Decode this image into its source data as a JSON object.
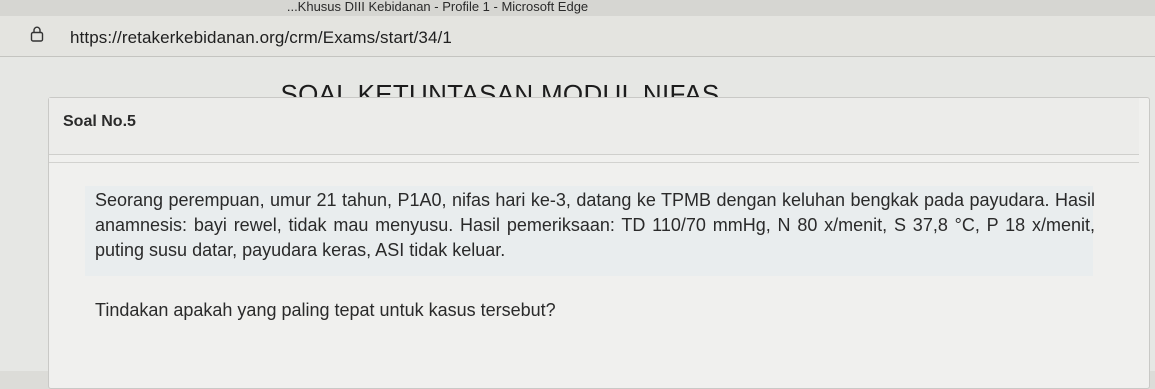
{
  "window": {
    "title": "...Khusus DIII Kebidanan - Profile 1 - Microsoft Edge"
  },
  "address_bar": {
    "url": "https://retakerkebidanan.org/crm/Exams/start/34/1",
    "lock_icon": "lock-icon"
  },
  "exam": {
    "title": "SOAL KETUNTASAN MODUL NIFAS",
    "question_number": "Soal No.5",
    "question_text": "Seorang perempuan, umur 21 tahun, P1A0, nifas hari ke-3, datang ke TPMB dengan keluhan bengkak pada payudara. Hasil anamnesis: bayi rewel, tidak mau menyusu. Hasil pemeriksaan: TD 110/70 mmHg, N 80 x/menit, S 37,8 °C, P 18 x/menit, puting susu datar, payudara keras, ASI tidak keluar.",
    "prompt": "Tindakan apakah yang paling tepat untuk kasus tersebut?"
  }
}
